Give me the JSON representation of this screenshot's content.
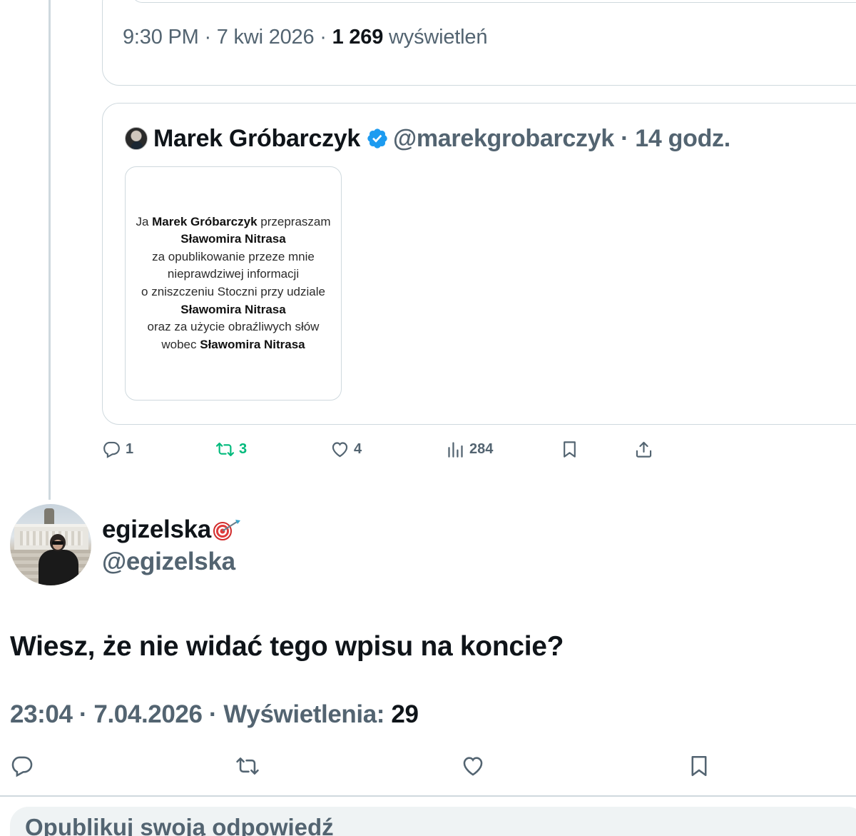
{
  "top_tweet": {
    "time": "9:30 PM · 7 kwi 2026 · ",
    "views_count": "1 269",
    "views_label": " wyświetleń"
  },
  "quoted_tweet": {
    "author_name": "Marek Gróbarczyk",
    "handle_time": "@marekgrobarczyk · 14 godz.",
    "image_text": {
      "l1a": "Ja ",
      "l1b": "Marek Gróbarczyk",
      "l1c": " przepraszam",
      "l2": "Sławomira Nitrasa",
      "l3": "za opublikowanie przeze mnie",
      "l4": "nieprawdziwej informacji",
      "l5": "o zniszczeniu Stoczni przy udziale",
      "l6": "Sławomira Nitrasa",
      "l7": "oraz za użycie obraźliwych słów",
      "l8a": "wobec ",
      "l8b": "Sławomira Nitrasa"
    },
    "actions": {
      "replies": "1",
      "retweets": "3",
      "likes": "4",
      "views": "284"
    }
  },
  "reply_tweet": {
    "author_name": "egizelska",
    "handle": "@egizelska",
    "text": "Wiesz, że nie widać tego wpisu na koncie?",
    "meta": "23:04 · 7.04.2026 · Wyświetlenia: ",
    "views": "29"
  },
  "composer": {
    "placeholder": "Opublikuj swoją odpowiedź"
  },
  "colors": {
    "text": "#0f1419",
    "secondary": "#536471",
    "border": "#cfd9de",
    "verified": "#1d9bf0",
    "retweet_active": "#00ba7c"
  },
  "icons": [
    "reply-icon",
    "retweet-icon",
    "like-icon",
    "views-icon",
    "bookmark-icon",
    "share-icon",
    "verified-badge-icon",
    "dart-target-icon"
  ]
}
